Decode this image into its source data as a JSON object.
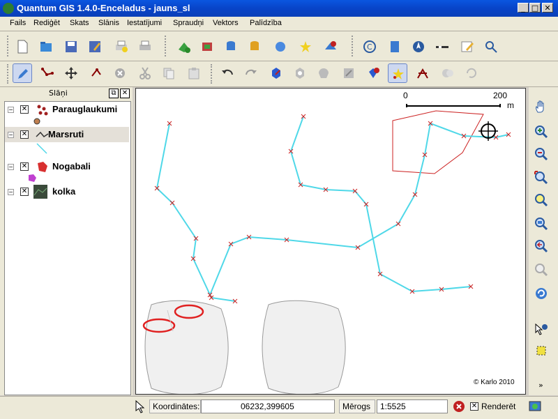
{
  "window": {
    "title": "Quantum GIS 1.4.0-Enceladus - jauns_sl"
  },
  "menu": [
    "Fails",
    "Rediģēt",
    "Skats",
    "Slānis",
    "Iestatījumi",
    "Spraudņi",
    "Vektors",
    "Palīdzība"
  ],
  "layers_panel": {
    "title": "Slāņi",
    "layers": [
      {
        "name": "Parauglaukumi",
        "checked": true,
        "selected": false
      },
      {
        "name": "Marsruti",
        "checked": true,
        "selected": true
      },
      {
        "name": "Nogabali",
        "checked": true,
        "selected": false
      },
      {
        "name": "kolka",
        "checked": true,
        "selected": false
      }
    ]
  },
  "map": {
    "scalebar": {
      "start": "0",
      "end": "200",
      "unit": "m"
    },
    "copyright": "© Karlo 2010",
    "colors": {
      "route": "#4fd8e8",
      "vertex": "#cc2222",
      "polygon": "#cc2222"
    }
  },
  "statusbar": {
    "coords_label": "Koordinātes:",
    "coords_value": "06232,399605",
    "scale_label": "Mērogs",
    "scale_value": "1:5525",
    "render_label": "Renderēt",
    "render_checked": true
  }
}
